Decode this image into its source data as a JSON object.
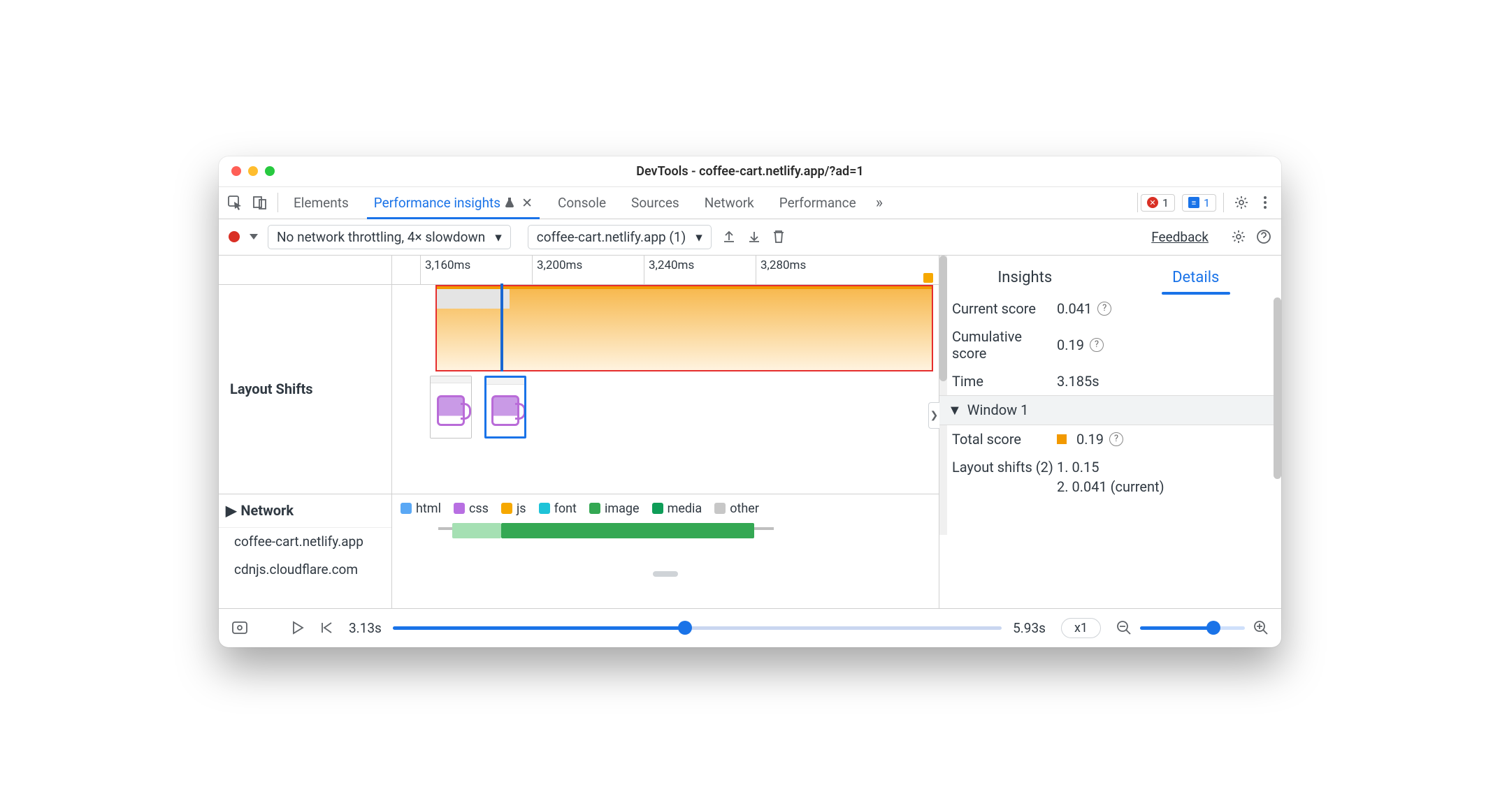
{
  "window": {
    "title": "DevTools - coffee-cart.netlify.app/?ad=1"
  },
  "tabs": {
    "items": [
      "Elements",
      "Performance insights",
      "Console",
      "Sources",
      "Network",
      "Performance"
    ],
    "active_index": 1,
    "overflow_glyph": "»",
    "error_count": "1",
    "issue_count": "1"
  },
  "toolbar": {
    "throttle_select": "No network throttling, 4× slowdown",
    "recording_select": "coffee-cart.netlify.app (1)",
    "feedback": "Feedback"
  },
  "ruler": {
    "ticks": [
      "3,160ms",
      "3,200ms",
      "3,240ms",
      "3,280ms"
    ]
  },
  "lanes": {
    "layout_shifts_label": "Layout Shifts",
    "network_label": "Network",
    "hosts": [
      "coffee-cart.netlify.app",
      "cdnjs.cloudflare.com"
    ]
  },
  "legend": {
    "html": "html",
    "css": "css",
    "js": "js",
    "font": "font",
    "image": "image",
    "media": "media",
    "other": "other"
  },
  "transport": {
    "start": "3.13s",
    "end": "5.93s",
    "speed": "x1"
  },
  "right": {
    "tab_insights": "Insights",
    "tab_details": "Details",
    "current_score_label": "Current score",
    "current_score": "0.041",
    "cumulative_label": "Cumulative score",
    "cumulative": "0.19",
    "time_label": "Time",
    "time": "3.185s",
    "window_label": "Window 1",
    "total_label": "Total score",
    "total": "0.19",
    "ls_label": "Layout shifts (2)",
    "ls1": "1. 0.15",
    "ls2": "2. 0.041 (current)"
  }
}
